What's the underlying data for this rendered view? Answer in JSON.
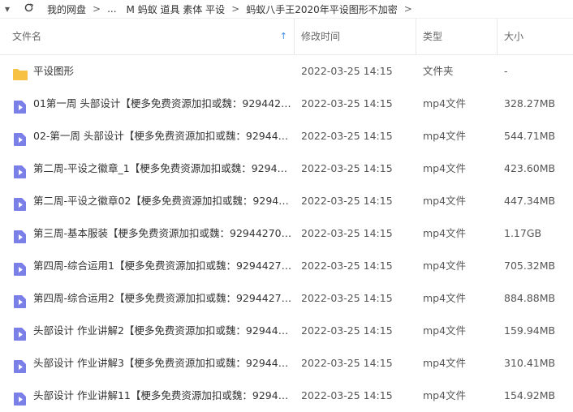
{
  "breadcrumb": {
    "items": [
      "我的网盘",
      "...",
      "M 蚂蚁 道具 素体 平设",
      "蚂蚁八手王2020年平设图形不加密"
    ]
  },
  "icons": {
    "back": "chevron-down-icon",
    "refresh": "refresh-icon",
    "folder": "folder-icon",
    "video": "video-file-icon"
  },
  "columns": {
    "name": "文件名",
    "time": "修改时间",
    "type": "类型",
    "size": "大小"
  },
  "files": [
    {
      "name": "平设图形",
      "time": "2022-03-25 14:15",
      "type": "文件夹",
      "size": "-",
      "kind": "folder"
    },
    {
      "name": "01第一周 头部设计【梗多免费资源加扣或魏：92944270...",
      "time": "2022-03-25 14:15",
      "type": "mp4文件",
      "size": "328.27MB",
      "kind": "video"
    },
    {
      "name": "02-第一周 头部设计【梗多免费资源加扣或魏：9294427...",
      "time": "2022-03-25 14:15",
      "type": "mp4文件",
      "size": "544.71MB",
      "kind": "video"
    },
    {
      "name": "第二周-平设之徽章_1【梗多免费资源加扣或魏：929442...",
      "time": "2022-03-25 14:15",
      "type": "mp4文件",
      "size": "423.60MB",
      "kind": "video"
    },
    {
      "name": "第二周-平设之徽章02【梗多免费资源加扣或魏：929442...",
      "time": "2022-03-25 14:15",
      "type": "mp4文件",
      "size": "447.34MB",
      "kind": "video"
    },
    {
      "name": "第三周-基本服装【梗多免费资源加扣或魏：929442701...",
      "time": "2022-03-25 14:15",
      "type": "mp4文件",
      "size": "1.17GB",
      "kind": "video"
    },
    {
      "name": "第四周-综合运用1【梗多免费资源加扣或魏：929442701...",
      "time": "2022-03-25 14:15",
      "type": "mp4文件",
      "size": "705.32MB",
      "kind": "video"
    },
    {
      "name": "第四周-综合运用2【梗多免费资源加扣或魏：929442701...",
      "time": "2022-03-25 14:15",
      "type": "mp4文件",
      "size": "884.88MB",
      "kind": "video"
    },
    {
      "name": "头部设计 作业讲解2【梗多免费资源加扣或魏：9294427...",
      "time": "2022-03-25 14:15",
      "type": "mp4文件",
      "size": "159.94MB",
      "kind": "video"
    },
    {
      "name": "头部设计 作业讲解3【梗多免费资源加扣或魏：9294427...",
      "time": "2022-03-25 14:15",
      "type": "mp4文件",
      "size": "310.41MB",
      "kind": "video"
    },
    {
      "name": "头部设计 作业讲解11【梗多免费资源加扣或魏：929442...",
      "time": "2022-03-25 14:15",
      "type": "mp4文件",
      "size": "154.92MB",
      "kind": "video"
    }
  ],
  "colors": {
    "folder": "#f7c143",
    "video": "#7b7fe8",
    "accent": "#3d8ce8"
  }
}
